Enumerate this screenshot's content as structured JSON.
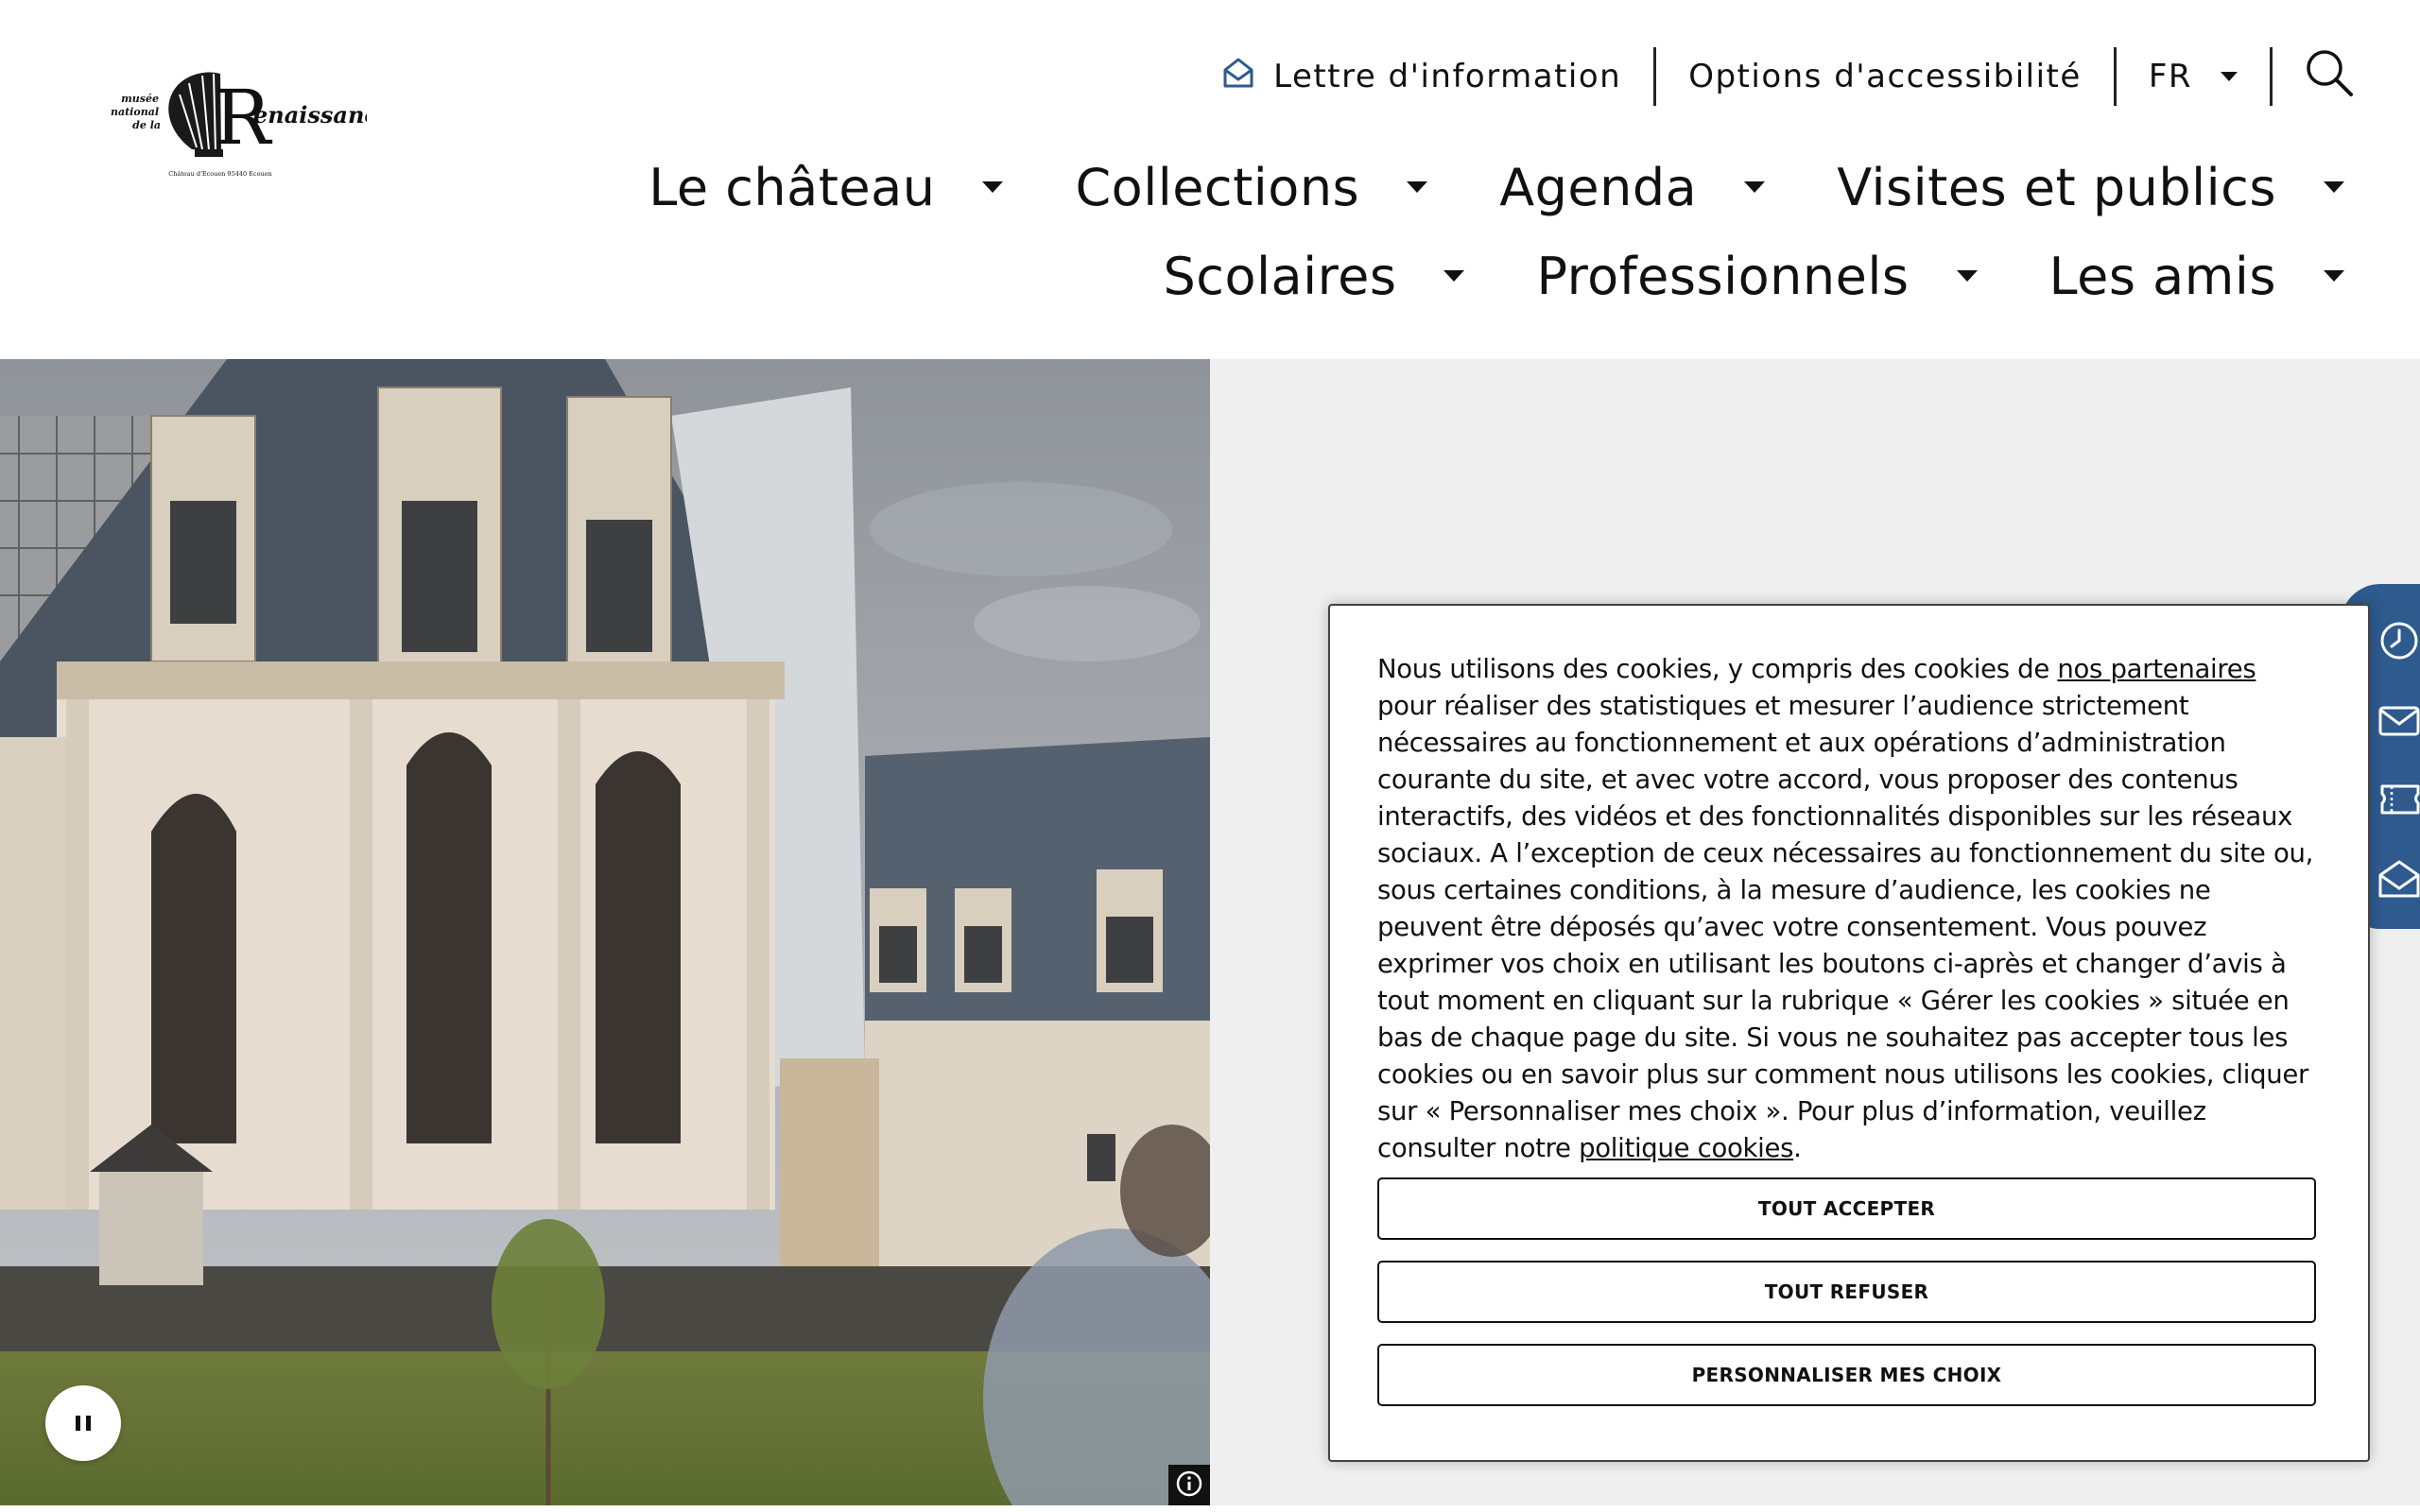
{
  "logo": {
    "line1": "musée",
    "line2": "national",
    "line3": "de la",
    "big_letter": "R",
    "wordmark": "enaissance",
    "caption": "Château d'Ecouen  95440 Ecouen"
  },
  "utility": {
    "newsletter_label": "Lettre d'information",
    "accessibility_label": "Options d'accessibilité",
    "language_label": "FR"
  },
  "nav": {
    "row1": [
      "Le château",
      "Collections",
      "Agenda",
      "Visites et publics"
    ],
    "row2": [
      "Scolaires",
      "Professionnels",
      "Les amis"
    ]
  },
  "cookie": {
    "text_part1": "Nous utilisons des cookies, y compris des cookies de ",
    "link_partners": "nos partenaires",
    "text_part2": " pour réaliser des statistiques et mesurer l’audience strictement nécessaires au fonctionnement et aux opérations d’administration courante du site, et avec votre accord, vous proposer des contenus interactifs, des vidéos et des fonctionnalités disponibles sur les réseaux sociaux. A l’exception de ceux nécessaires au fonctionnement du site ou, sous certaines conditions, à la mesure d’audience, les cookies ne peuvent être déposés qu’avec votre consentement. Vous pouvez exprimer vos choix en utilisant les boutons ci-après et changer d’avis à tout moment en cliquant sur la rubrique « Gérer les cookies » située en bas de chaque page du site. Si vous ne souhaitez pas accepter tous les cookies ou en savoir plus sur comment nous utilisons les cookies, cliquer sur « Personnaliser mes choix ». Pour plus d’information, veuillez consulter notre ",
    "link_policy": "politique cookies",
    "text_part3": ".",
    "accept_label": "TOUT ACCEPTER",
    "refuse_label": "TOUT REFUSER",
    "customize_label": "PERSONNALISER MES CHOIX"
  },
  "sidetab": {
    "icons": [
      "clock-icon",
      "mail-icon",
      "ticket-icon",
      "newsletter-icon"
    ]
  },
  "colors": {
    "accent": "#2e5a8e",
    "panel": "#efefef",
    "text": "#111111"
  }
}
